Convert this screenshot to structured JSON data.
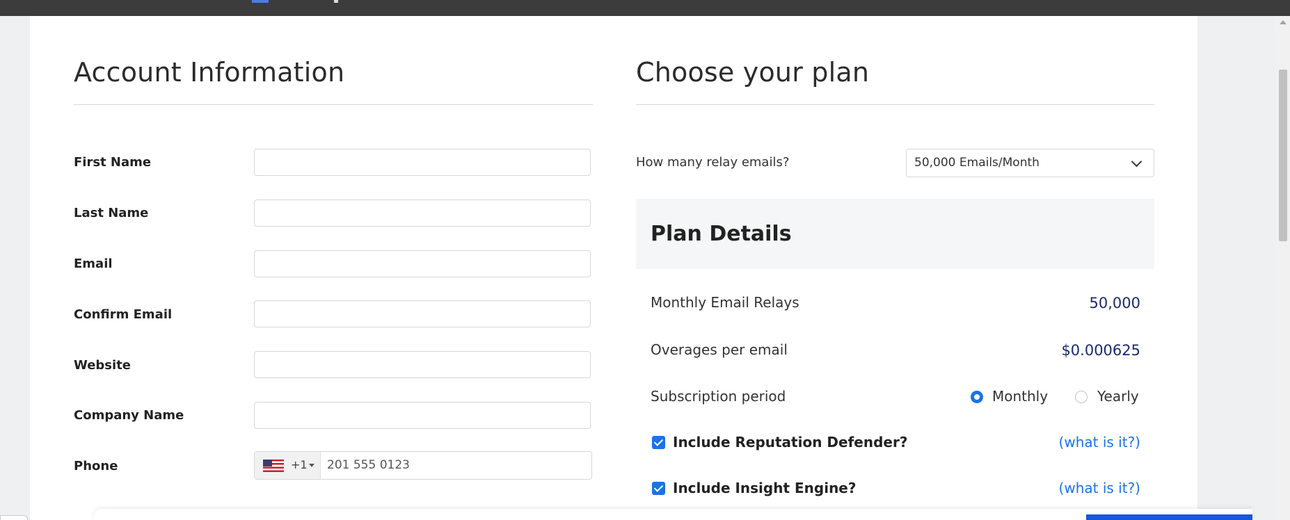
{
  "account": {
    "title": "Account Information",
    "fields": [
      {
        "label": "First Name",
        "value": ""
      },
      {
        "label": "Last Name",
        "value": ""
      },
      {
        "label": "Email",
        "value": ""
      },
      {
        "label": "Confirm Email",
        "value": ""
      },
      {
        "label": "Website",
        "value": ""
      },
      {
        "label": "Company Name",
        "value": ""
      }
    ],
    "phone": {
      "label": "Phone",
      "country_code": "+1",
      "placeholder": "201 555 0123"
    }
  },
  "plan": {
    "title": "Choose your plan",
    "relay_question": "How many relay emails?",
    "relay_selected": "50,000 Emails/Month",
    "details_title": "Plan Details",
    "monthly_relays_label": "Monthly Email Relays",
    "monthly_relays_value": "50,000",
    "overage_label": "Overages per email",
    "overage_value": "$0.000625",
    "period_label": "Subscription period",
    "period_options": [
      {
        "label": "Monthly",
        "selected": true
      },
      {
        "label": "Yearly",
        "selected": false
      }
    ],
    "addons": [
      {
        "label": "Include Reputation Defender?",
        "checked": true,
        "link": "(what is it?)"
      },
      {
        "label": "Include Insight Engine?",
        "checked": true,
        "link": "(what is it?)"
      }
    ]
  },
  "colors": {
    "accent": "#1a73e8",
    "value_text": "#1a2a6c",
    "panel_bg": "#f5f6f8"
  },
  "icons": [
    "us-flag-icon",
    "caret-down-icon",
    "chevron-down-icon"
  ]
}
